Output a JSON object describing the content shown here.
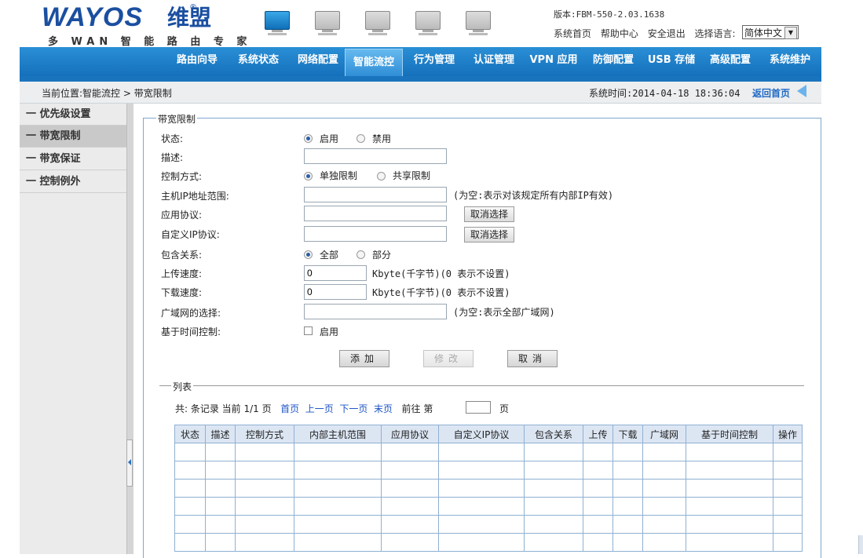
{
  "header": {
    "logo_text": "WAYOS",
    "logo_cn": "维盟",
    "slogan": "多 WAN 智 能 路 由 专 家",
    "version": "版本:FBM-550-2.03.1638",
    "links": [
      "系统首页",
      "帮助中心",
      "安全退出",
      "选择语言:"
    ],
    "language": "简体中文",
    "monitor_icons": [
      "monitor-icon-active",
      "monitor-icon",
      "monitor-icon",
      "monitor-icon",
      "monitor-icon"
    ]
  },
  "nav": {
    "items": [
      "路由向导",
      "系统状态",
      "网络配置",
      "智能流控",
      "行为管理",
      "认证管理",
      "VPN 应用",
      "防御配置",
      "USB 存储",
      "高级配置",
      "系统维护"
    ],
    "active_index": 3
  },
  "breadcrumb": {
    "text": "当前位置:智能流控 > 带宽限制",
    "system_time": "系统时间:2014-04-18 18:36:04",
    "home": "返回首页"
  },
  "sidebar": {
    "items": [
      "一 优先级设置",
      "一 带宽限制",
      "一 带宽保证",
      "一 控制例外"
    ],
    "active_index": 1
  },
  "form": {
    "legend": "带宽限制",
    "status_label": "状态:",
    "status_options": [
      "启用",
      "禁用"
    ],
    "status_selected": "启用",
    "desc_label": "描述:",
    "desc_value": "",
    "mode_label": "控制方式:",
    "mode_options": [
      "单独限制",
      "共享限制"
    ],
    "mode_selected": "单独限制",
    "ip_label": "主机IP地址范围:",
    "ip_value": "",
    "ip_hint": "(为空:表示对该规定所有内部IP有效)",
    "app_label": "应用协议:",
    "app_value": "",
    "app_cancel": "取消选择",
    "custom_label": "自定义IP协议:",
    "custom_value": "",
    "custom_cancel": "取消选择",
    "include_label": "包含关系:",
    "include_options": [
      "全部",
      "部分"
    ],
    "include_selected": "全部",
    "upload_label": "上传速度:",
    "upload_value": "0",
    "upload_hint": "Kbyte(千字节)(0 表示不设置)",
    "download_label": "下载速度:",
    "download_value": "0",
    "download_hint": "Kbyte(千字节)(0 表示不设置)",
    "wan_label": "广域网的选择:",
    "wan_value": "",
    "wan_hint": "(为空:表示全部广域网)",
    "time_label": "基于时间控制:",
    "time_option": "启用",
    "time_checked": false,
    "buttons": {
      "add": "添加",
      "modify": "修改",
      "cancel": "取消"
    }
  },
  "list": {
    "legend": "列表",
    "pager": {
      "summary": "共: 条记录 当前 1/1 页",
      "first": "首页",
      "prev": "上一页",
      "next": "下一页",
      "last": "末页",
      "goto_prefix": "前往 第",
      "goto_suffix": "页",
      "goto_value": ""
    },
    "columns": [
      "状态",
      "描述",
      "控制方式",
      "内部主机范围",
      "应用协议",
      "自定义IP协议",
      "包含关系",
      "上传",
      "下载",
      "广域网",
      "基于时间控制",
      "操作"
    ],
    "rows": []
  }
}
